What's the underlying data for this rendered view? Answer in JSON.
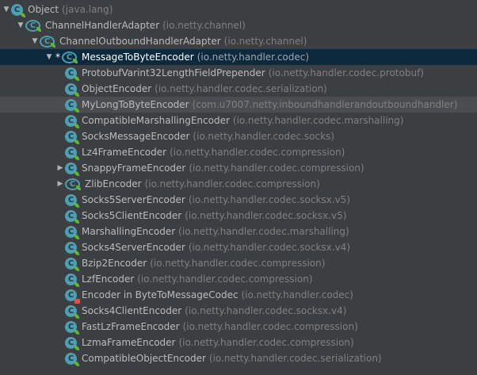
{
  "rows": [
    {
      "name": "Object",
      "pkg": "(java.lang)",
      "expander": "▼",
      "marker": "",
      "icon": "C"
    },
    {
      "name": "ChannelHandlerAdapter",
      "pkg": "(io.netty.channel)",
      "expander": "▼",
      "marker": "",
      "icon": "C"
    },
    {
      "name": "ChannelOutboundHandlerAdapter",
      "pkg": "(io.netty.channel)",
      "expander": "▼",
      "marker": "",
      "icon": "C"
    },
    {
      "name": "MessageToByteEncoder",
      "pkg": "(io.netty.handler.codec)",
      "expander": "▼",
      "marker": "*",
      "icon": "C"
    },
    {
      "name": "ProtobufVarint32LengthFieldPrepender",
      "pkg": "(io.netty.handler.codec.protobuf)",
      "expander": "",
      "marker": "",
      "icon": "C"
    },
    {
      "name": "ObjectEncoder",
      "pkg": "(io.netty.handler.codec.serialization)",
      "expander": "",
      "marker": "",
      "icon": "C"
    },
    {
      "name": "MyLongToByteEncoder",
      "pkg": "(com.u7007.netty.inboundhandlerandoutboundhandler)",
      "expander": "",
      "marker": "",
      "icon": "C"
    },
    {
      "name": "CompatibleMarshallingEncoder",
      "pkg": "(io.netty.handler.codec.marshalling)",
      "expander": "",
      "marker": "",
      "icon": "C"
    },
    {
      "name": "SocksMessageEncoder",
      "pkg": "(io.netty.handler.codec.socks)",
      "expander": "",
      "marker": "",
      "icon": "C"
    },
    {
      "name": "Lz4FrameEncoder",
      "pkg": "(io.netty.handler.codec.compression)",
      "expander": "",
      "marker": "",
      "icon": "C"
    },
    {
      "name": "SnappyFrameEncoder",
      "pkg": "(io.netty.handler.codec.compression)",
      "expander": "▶",
      "marker": "",
      "icon": "C"
    },
    {
      "name": "ZlibEncoder",
      "pkg": "(io.netty.handler.codec.compression)",
      "expander": "▶",
      "marker": "",
      "icon": "C"
    },
    {
      "name": "Socks5ServerEncoder",
      "pkg": "(io.netty.handler.codec.socksx.v5)",
      "expander": "",
      "marker": "",
      "icon": "C"
    },
    {
      "name": "Socks5ClientEncoder",
      "pkg": "(io.netty.handler.codec.socksx.v5)",
      "expander": "",
      "marker": "",
      "icon": "C"
    },
    {
      "name": "MarshallingEncoder",
      "pkg": "(io.netty.handler.codec.marshalling)",
      "expander": "",
      "marker": "",
      "icon": "C"
    },
    {
      "name": "Socks4ServerEncoder",
      "pkg": "(io.netty.handler.codec.socksx.v4)",
      "expander": "",
      "marker": "",
      "icon": "C"
    },
    {
      "name": "Bzip2Encoder",
      "pkg": "(io.netty.handler.codec.compression)",
      "expander": "",
      "marker": "",
      "icon": "C"
    },
    {
      "name": "LzfEncoder",
      "pkg": "(io.netty.handler.codec.compression)",
      "expander": "",
      "marker": "",
      "icon": "C"
    },
    {
      "name": "Encoder in ByteToMessageCodec",
      "pkg": "(io.netty.handler.codec)",
      "expander": "",
      "marker": "",
      "icon": "C"
    },
    {
      "name": "Socks4ClientEncoder",
      "pkg": "(io.netty.handler.codec.socksx.v4)",
      "expander": "",
      "marker": "",
      "icon": "C"
    },
    {
      "name": "FastLzFrameEncoder",
      "pkg": "(io.netty.handler.codec.compression)",
      "expander": "",
      "marker": "",
      "icon": "C"
    },
    {
      "name": "LzmaFrameEncoder",
      "pkg": "(io.netty.handler.codec.compression)",
      "expander": "",
      "marker": "",
      "icon": "C"
    },
    {
      "name": "CompatibleObjectEncoder",
      "pkg": "(io.netty.handler.codec.serialization)",
      "expander": "",
      "marker": "",
      "icon": "C"
    }
  ],
  "colors": {
    "background": "#3c3f41",
    "selected": "#0d293e",
    "highlight": "#4b4d50",
    "class_icon": "#4e9fb3",
    "leaf_badge": "#62b543",
    "lock_badge": "#d9534f"
  },
  "icons": {
    "class": "class-icon",
    "abstract_class": "abstract-class-icon",
    "leaf": "leaf-icon",
    "lock": "lock-icon"
  }
}
